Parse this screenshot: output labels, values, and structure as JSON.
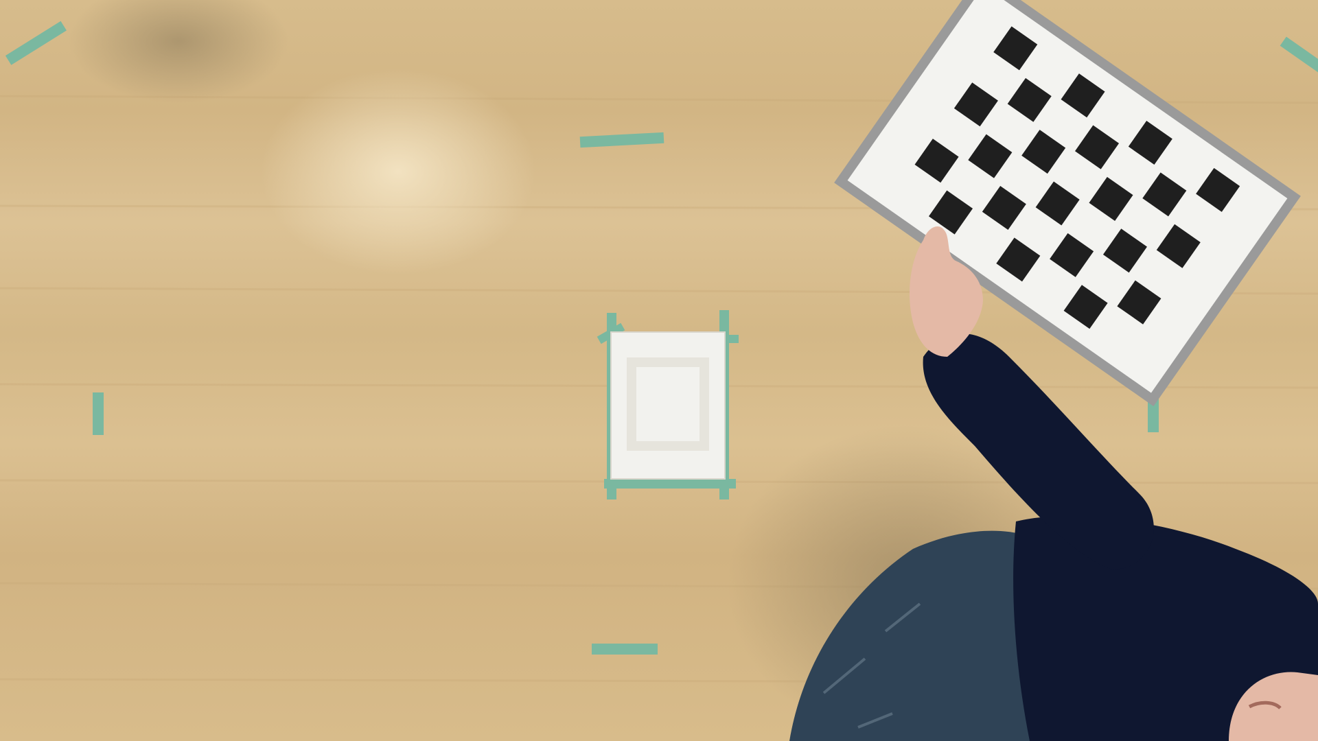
{
  "scene": {
    "floor_color": "#d8bd8c",
    "tape_color": "#7ab8a0",
    "paper_color": "#f2f2ee",
    "board_frame_color": "#9a9a9a",
    "board_face_color": "#f3f3f0",
    "board_square_color": "#1f1f1f",
    "sleeve_color": "#0f1730",
    "jeans_color": "#2f4356",
    "skin_color": "#e4b9a6"
  },
  "checkerboard": {
    "rows": 5,
    "cols": 6
  }
}
